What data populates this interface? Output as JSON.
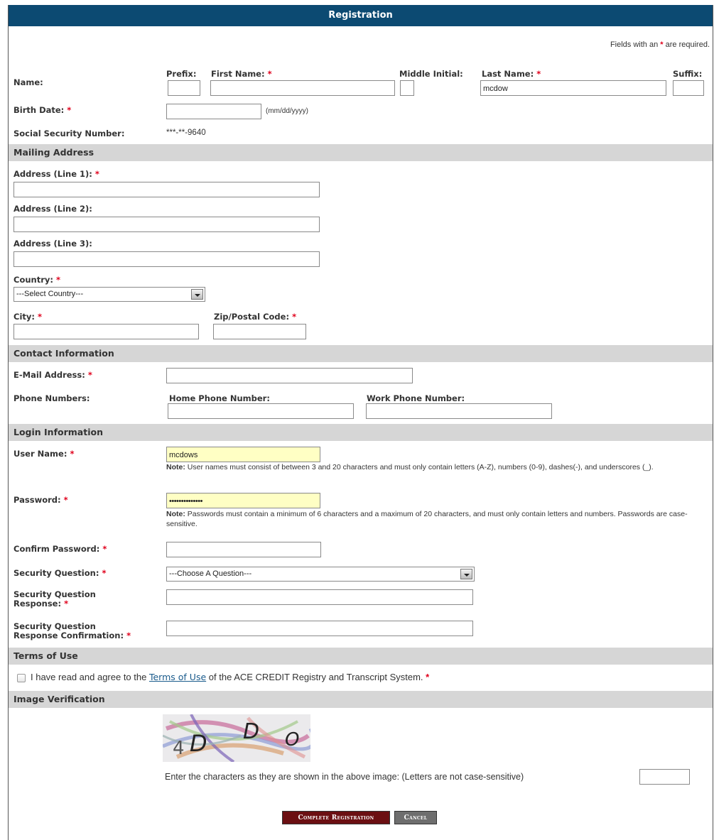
{
  "header": {
    "title": "Registration"
  },
  "required_note": {
    "prefix": "Fields with an",
    "star": "*",
    "suffix": "are required."
  },
  "personal": {
    "name_label": "Name:",
    "prefix_label": "Prefix:",
    "first_name_label": "First Name:",
    "middle_initial_label": "Middle Initial:",
    "last_name_label": "Last Name:",
    "suffix_label": "Suffix:",
    "prefix_value": "",
    "first_name_value": "",
    "middle_initial_value": "",
    "last_name_value": "mcdow",
    "suffix_value": "",
    "birth_date_label": "Birth Date:",
    "birth_date_value": "",
    "birth_date_hint": "(mm/dd/yyyy)",
    "ssn_label": "Social Security Number:",
    "ssn_value": "***-**-9640",
    "required_star": "*"
  },
  "mailing": {
    "section_title": "Mailing Address",
    "address1_label": "Address (Line 1):",
    "address2_label": "Address (Line 2):",
    "address3_label": "Address (Line 3):",
    "address1_value": "",
    "address2_value": "",
    "address3_value": "",
    "country_label": "Country:",
    "country_selected": "---Select Country---",
    "city_label": "City:",
    "city_value": "",
    "zip_label": "Zip/Postal Code:",
    "zip_value": ""
  },
  "contact": {
    "section_title": "Contact Information",
    "email_label": "E-Mail Address:",
    "email_value": "",
    "phone_label": "Phone Numbers:",
    "home_phone_label": "Home Phone Number:",
    "work_phone_label": "Work Phone Number:",
    "home_phone_value": "",
    "work_phone_value": ""
  },
  "login": {
    "section_title": "Login Information",
    "username_label": "User Name:",
    "username_value": "mcdows",
    "username_note_bold": "Note:",
    "username_note": "User names must consist of between 3 and 20 characters and must only contain letters (A-Z), numbers (0-9), dashes(-), and underscores (_).",
    "password_label": "Password:",
    "password_value": "••••••••••••••",
    "password_note_bold": "Note:",
    "password_note": "Passwords must contain a minimum of 6 characters and a maximum of 20 characters, and must only contain letters and numbers. Passwords are case-sensitive.",
    "confirm_password_label": "Confirm Password:",
    "confirm_password_value": "",
    "security_question_label": "Security Question:",
    "security_question_selected": "---Choose A Question---",
    "security_response_label_1": "Security Question",
    "security_response_label_2": "Response:",
    "security_response_value": "",
    "security_confirm_label_1": "Security Question",
    "security_confirm_label_2": "Response Confirmation:",
    "security_confirm_value": ""
  },
  "terms": {
    "section_title": "Terms of Use",
    "text_before": "I have read and agree to the",
    "link_text": "Terms of Use",
    "text_after": "of the ACE CREDIT Registry and Transcript System.",
    "checked": false
  },
  "verification": {
    "section_title": "Image Verification",
    "captcha_chars": [
      "4",
      "D",
      "D",
      "O"
    ],
    "instruction": "Enter the characters as they are shown in the above image: (Letters are not case-sensitive)",
    "captcha_value": ""
  },
  "buttons": {
    "complete": "Complete Registration",
    "cancel": "Cancel"
  },
  "colors": {
    "title_bar": "#0c4a72",
    "section_bg": "#d6d6d6",
    "required": "#e0001b",
    "highlight_input": "#ffffc4",
    "complete_button": "#6b0f12",
    "cancel_button": "#6e6e6e"
  },
  "icons": {
    "dropdown": "chevron-down-icon",
    "checkbox": "checkbox-icon"
  }
}
